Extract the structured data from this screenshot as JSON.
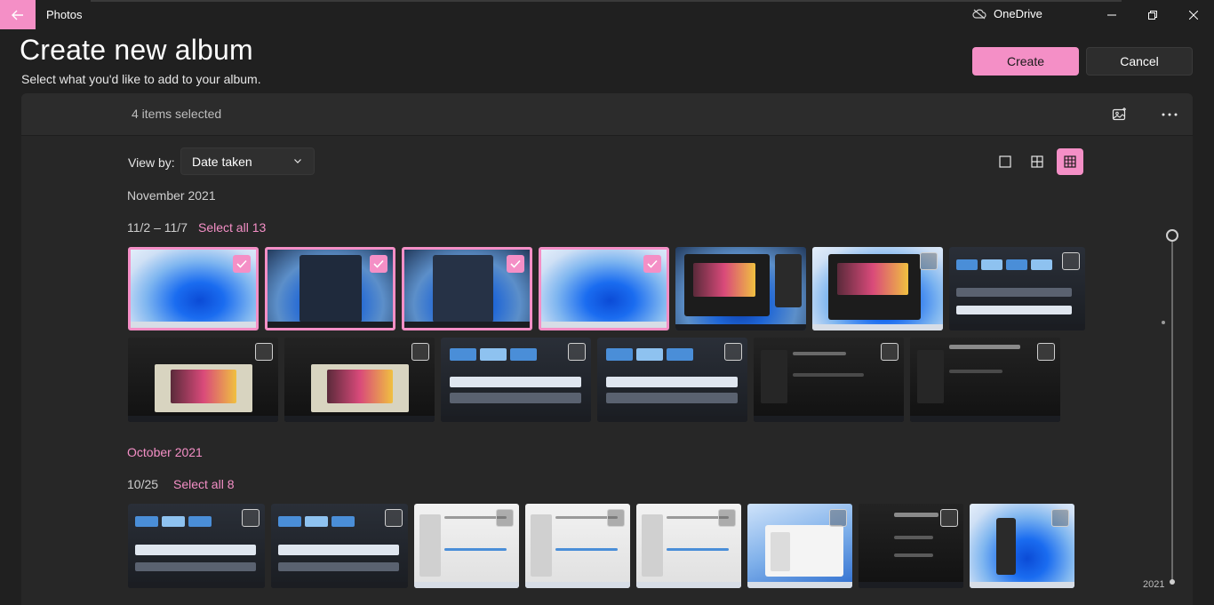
{
  "app": {
    "title": "Photos",
    "onedrive_label": "OneDrive"
  },
  "header": {
    "title": "Create new album",
    "subtitle": "Select what you'd like to add to your album.",
    "create_label": "Create",
    "cancel_label": "Cancel"
  },
  "toolbar": {
    "selected_count": "4 items selected"
  },
  "view": {
    "label": "View by:",
    "selected": "Date taken"
  },
  "groups": [
    {
      "month": "November 2021",
      "range": "11/2 – 11/7",
      "select_all": "Select all 13"
    },
    {
      "month": "October 2021",
      "range": "10/25",
      "select_all": "Select all 8"
    }
  ],
  "timeline": {
    "year": "2021"
  },
  "colors": {
    "accent": "#f48fc6",
    "background": "#202020",
    "panel": "#272727"
  }
}
